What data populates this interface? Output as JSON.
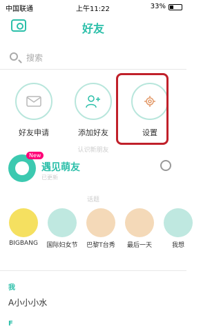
{
  "status": {
    "carrier": "中国联通",
    "time": "上午11:22",
    "battery": "33%"
  },
  "nav": {
    "title": "好友"
  },
  "search": {
    "placeholder": "搜索"
  },
  "actions": [
    {
      "label": "好友申请"
    },
    {
      "label": "添加好友"
    },
    {
      "label": "设置"
    }
  ],
  "discover": {
    "caption": "认识新朋友"
  },
  "meet": {
    "title": "遇见萌友",
    "badge": "New",
    "sub": "已更新"
  },
  "topics_header": "话题",
  "topics": [
    {
      "label": "BIGBANG"
    },
    {
      "label": "国际妇女节"
    },
    {
      "label": "巴黎T台秀"
    },
    {
      "label": "最后一天"
    },
    {
      "label": "我想"
    }
  ],
  "contacts": [
    {
      "index": "我",
      "name": "A小小小水"
    },
    {
      "index": "F",
      "name": ""
    }
  ],
  "colors": {
    "accent": "#2bbfa9",
    "highlight": "#c0202a"
  }
}
